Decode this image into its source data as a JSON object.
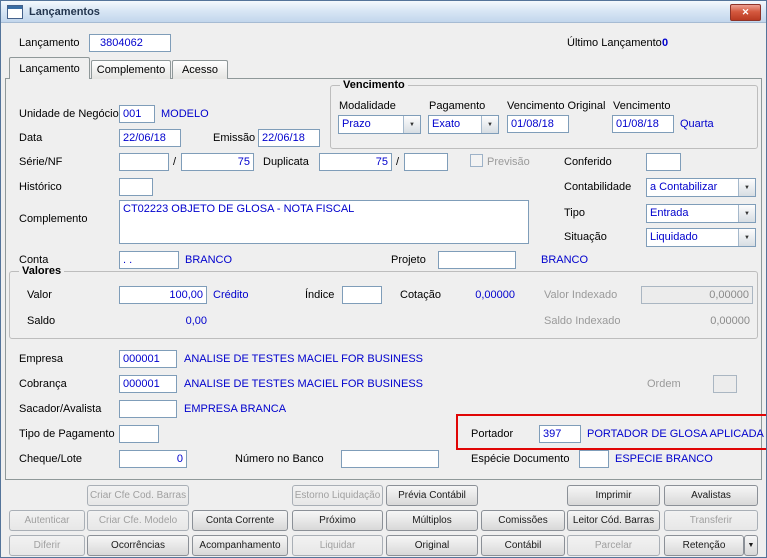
{
  "window": {
    "title": "Lançamentos",
    "close_glyph": "✕"
  },
  "header": {
    "lancamento_label": "Lançamento",
    "lancamento_value": "3804062",
    "ultimo_lancamento_label": "Último Lançamento",
    "ultimo_lancamento_value": "0"
  },
  "tabs": [
    {
      "label": "Lançamento",
      "active": true
    },
    {
      "label": "Complemento",
      "active": false
    },
    {
      "label": "Acesso",
      "active": false
    }
  ],
  "vencimento": {
    "title": "Vencimento",
    "modalidade_label": "Modalidade",
    "modalidade_value": "Prazo",
    "pagamento_label": "Pagamento",
    "pagamento_value": "Exato",
    "vencimento_original_label": "Vencimento Original",
    "vencimento_original_value": "01/08/18",
    "vencimento_label": "Vencimento",
    "vencimento_value": "01/08/18",
    "vencimento_weekday": "Quarta"
  },
  "fields": {
    "unidade_negocio": {
      "label": "Unidade de Negócio",
      "value": "001",
      "desc": "MODELO"
    },
    "data": {
      "label": "Data",
      "value": "22/06/18"
    },
    "emissao": {
      "label": "Emissão",
      "value": "22/06/18"
    },
    "serie_nf": {
      "label": "Série/NF",
      "value1": "",
      "separator": "/",
      "value2": "75"
    },
    "duplicata": {
      "label": "Duplicata",
      "value1": "75",
      "separator": "/",
      "value2": ""
    },
    "previsao": {
      "label": "Previsão",
      "checked": false
    },
    "conferido": {
      "label": "Conferido",
      "value": ""
    },
    "historico": {
      "label": "Histórico",
      "value": ""
    },
    "contabilidade": {
      "label": "Contabilidade",
      "value": "a Contabilizar"
    },
    "complemento": {
      "label": "Complemento",
      "value": "CT02223 OBJETO DE GLOSA - NOTA FISCAL"
    },
    "tipo": {
      "label": "Tipo",
      "value": "Entrada"
    },
    "situacao": {
      "label": "Situação",
      "value": "Liquidado"
    },
    "conta": {
      "label": "Conta",
      "value": ". .",
      "desc": "BRANCO"
    },
    "projeto": {
      "label": "Projeto",
      "value": "",
      "desc": "BRANCO"
    },
    "empresa": {
      "label": "Empresa",
      "value": "000001",
      "desc": "ANALISE DE TESTES MACIEL FOR BUSINESS"
    },
    "cobranca": {
      "label": "Cobrança",
      "value": "000001",
      "desc": "ANALISE DE TESTES MACIEL FOR BUSINESS"
    },
    "ordem": {
      "label": "Ordem",
      "value": ""
    },
    "sacador_avalista": {
      "label": "Sacador/Avalista",
      "value": "",
      "desc": "EMPRESA BRANCA"
    },
    "tipo_pagamento": {
      "label": "Tipo de Pagamento",
      "value": ""
    },
    "portador": {
      "label": "Portador",
      "value": "397",
      "desc": "PORTADOR DE GLOSA APLICADA"
    },
    "cheque_lote": {
      "label": "Cheque/Lote",
      "value": "0"
    },
    "numero_banco": {
      "label": "Número no Banco",
      "value": ""
    },
    "especie_documento": {
      "label": "Espécie Documento",
      "value": "",
      "desc": "ESPECIE BRANCO"
    }
  },
  "valores": {
    "title": "Valores",
    "valor_label": "Valor",
    "valor_value": "100,00",
    "valor_desc": "Crédito",
    "indice_label": "Índice",
    "indice_value": "",
    "cotacao_label": "Cotação",
    "cotacao_value": "0,00000",
    "valor_indexado_label": "Valor Indexado",
    "valor_indexado_value": "0,00000",
    "saldo_label": "Saldo",
    "saldo_value": "0,00",
    "saldo_indexado_label": "Saldo Indexado",
    "saldo_indexado_value": "0,00000"
  },
  "buttons": [
    {
      "label": "Criar Cfe Cod. Barras",
      "disabled": true
    },
    {
      "label": "Estorno Liquidação",
      "disabled": true
    },
    {
      "label": "Prévia Contábil",
      "disabled": false
    },
    {
      "label": "Imprimir",
      "disabled": false
    },
    {
      "label": "Avalistas",
      "disabled": false
    },
    {
      "label": "Autenticar",
      "disabled": true
    },
    {
      "label": "Criar Cfe. Modelo",
      "disabled": true
    },
    {
      "label": "Conta Corrente",
      "disabled": false
    },
    {
      "label": "Próximo",
      "disabled": false
    },
    {
      "label": "Múltiplos",
      "disabled": false
    },
    {
      "label": "Comissões",
      "disabled": false
    },
    {
      "label": "Leitor Cód. Barras",
      "disabled": false
    },
    {
      "label": "Transferir",
      "disabled": true
    },
    {
      "label": "Diferir",
      "disabled": true
    },
    {
      "label": "Ocorrências",
      "disabled": false
    },
    {
      "label": "Acompanhamento",
      "disabled": false
    },
    {
      "label": "Liquidar",
      "disabled": true
    },
    {
      "label": "Original",
      "disabled": false
    },
    {
      "label": "Contábil",
      "disabled": false
    },
    {
      "label": "Parcelar",
      "disabled": true
    },
    {
      "label": "Retenção",
      "disabled": false
    }
  ],
  "retencao_arrow": "▼",
  "combo_arrow": "▼",
  "colors": {
    "value_blue": "#0000CD",
    "annotation_red": "#E00505"
  }
}
